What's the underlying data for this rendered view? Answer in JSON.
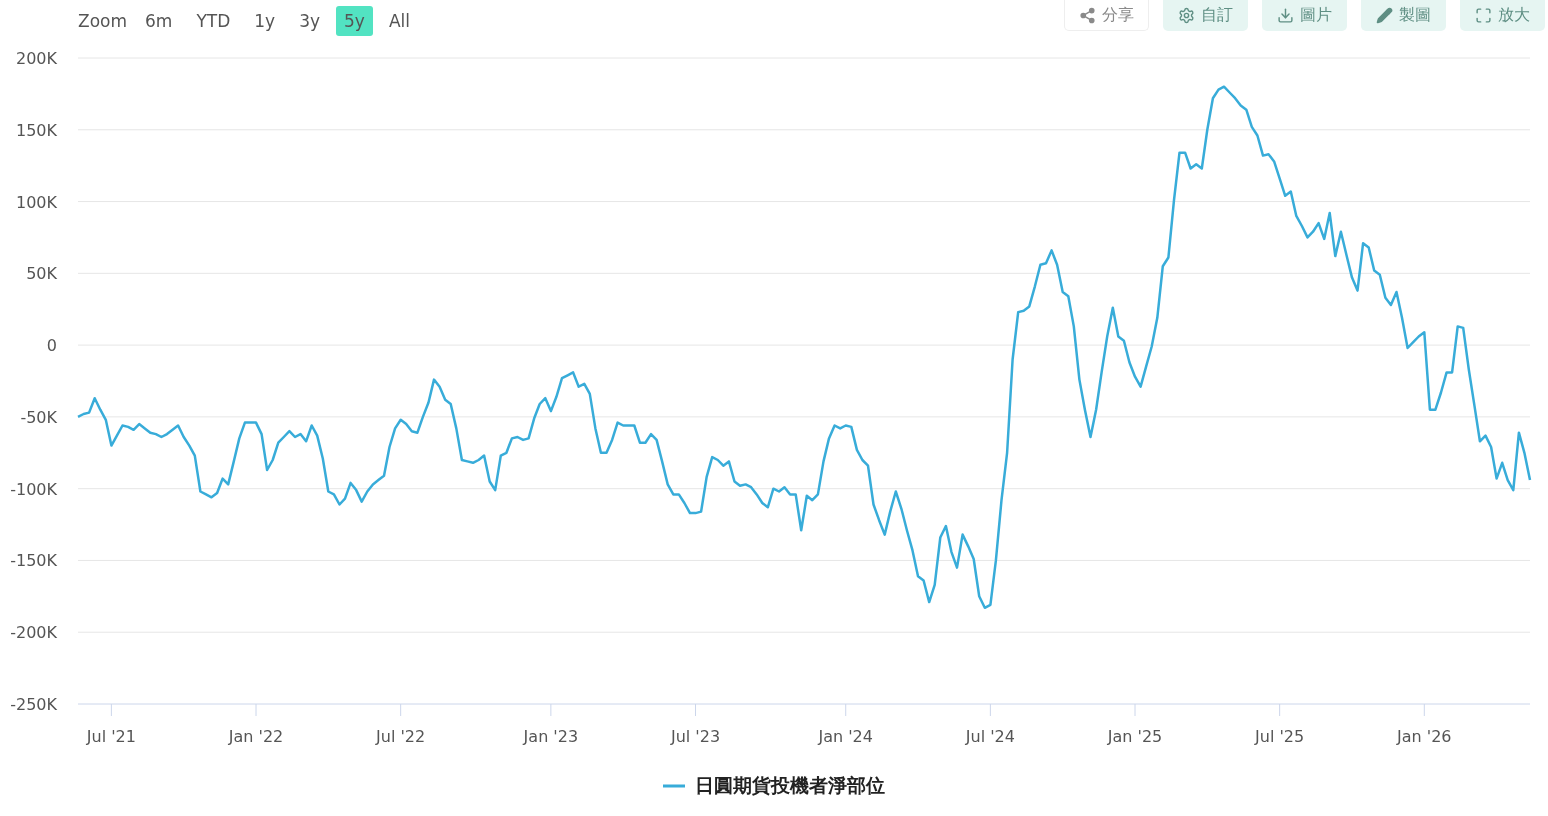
{
  "range_selector": {
    "label": "Zoom",
    "buttons": [
      {
        "label": "6m",
        "selected": false
      },
      {
        "label": "YTD",
        "selected": false
      },
      {
        "label": "1y",
        "selected": false
      },
      {
        "label": "3y",
        "selected": false
      },
      {
        "label": "5y",
        "selected": true
      },
      {
        "label": "All",
        "selected": false
      }
    ]
  },
  "toolbar": [
    {
      "kind": "share",
      "label": "分享"
    },
    {
      "kind": "settings",
      "label": "自訂"
    },
    {
      "kind": "download",
      "label": "圖片"
    },
    {
      "kind": "edit",
      "label": "製圖"
    },
    {
      "kind": "expand",
      "label": "放大"
    }
  ],
  "chart": {
    "chart_data": {
      "type": "line",
      "grid": true,
      "ylim": [
        -250,
        200
      ],
      "yticks": [
        {
          "value": 200,
          "label": "200K"
        },
        {
          "value": 150,
          "label": "150K"
        },
        {
          "value": 100,
          "label": "100K"
        },
        {
          "value": 50,
          "label": "50K"
        },
        {
          "value": 0,
          "label": "0"
        },
        {
          "value": -50,
          "label": "-50K"
        },
        {
          "value": -100,
          "label": "-100K"
        },
        {
          "value": -150,
          "label": "-150K"
        },
        {
          "value": -200,
          "label": "-200K"
        },
        {
          "value": -250,
          "label": "-250K"
        }
      ],
      "categories": [
        null,
        null,
        null,
        null,
        null,
        null,
        "Jul '21",
        null,
        null,
        null,
        null,
        null,
        null,
        null,
        null,
        null,
        null,
        null,
        null,
        null,
        null,
        null,
        null,
        null,
        null,
        null,
        null,
        null,
        null,
        null,
        null,
        null,
        "Jan '22",
        null,
        null,
        null,
        null,
        null,
        null,
        null,
        null,
        null,
        null,
        null,
        null,
        null,
        null,
        null,
        null,
        null,
        null,
        null,
        null,
        null,
        null,
        null,
        null,
        null,
        "Jul '22",
        null,
        null,
        null,
        null,
        null,
        null,
        null,
        null,
        null,
        null,
        null,
        null,
        null,
        null,
        null,
        null,
        null,
        null,
        null,
        null,
        null,
        null,
        null,
        null,
        null,
        null,
        "Jan '23",
        null,
        null,
        null,
        null,
        null,
        null,
        null,
        null,
        null,
        null,
        null,
        null,
        null,
        null,
        null,
        null,
        null,
        null,
        null,
        null,
        null,
        null,
        null,
        null,
        null,
        "Jul '23",
        null,
        null,
        null,
        null,
        null,
        null,
        null,
        null,
        null,
        null,
        null,
        null,
        null,
        null,
        null,
        null,
        null,
        null,
        null,
        null,
        null,
        null,
        null,
        null,
        null,
        null,
        "Jan '24",
        null,
        null,
        null,
        null,
        null,
        null,
        null,
        null,
        null,
        null,
        null,
        null,
        null,
        null,
        null,
        null,
        null,
        null,
        null,
        null,
        null,
        null,
        null,
        null,
        null,
        "Jul '24",
        null,
        null,
        null,
        null,
        null,
        null,
        null,
        null,
        null,
        null,
        null,
        null,
        null,
        null,
        null,
        null,
        null,
        null,
        null,
        null,
        null,
        null,
        null,
        null,
        null,
        "Jan '25",
        null,
        null,
        null,
        null,
        null,
        null,
        null,
        null,
        null,
        null,
        null,
        null,
        null,
        null,
        null,
        null,
        null,
        null,
        null,
        null,
        null,
        null,
        null,
        null,
        null,
        "Jul '25",
        null,
        null,
        null,
        null,
        null,
        null,
        null,
        null,
        null,
        null,
        null,
        null,
        null,
        null,
        null,
        null,
        null,
        null,
        null,
        null,
        null,
        null,
        null,
        null,
        null,
        "Jan '26",
        null,
        null,
        null,
        null,
        null,
        null,
        null,
        null,
        null,
        null,
        null,
        null,
        null,
        null,
        null,
        null,
        null,
        null,
        null
      ],
      "series": [
        {
          "name": "日圓期貨投機者淨部位",
          "color": "#38acd9",
          "values": [
            -50,
            -48,
            -47,
            -37,
            -45,
            -52,
            -70,
            -63,
            -56,
            -57,
            -59,
            -55,
            -58,
            -61,
            -62,
            -64,
            -62,
            -59,
            -56,
            -64,
            -70,
            -77,
            -102,
            -104,
            -106,
            -103,
            -93,
            -97,
            -81,
            -65,
            -54,
            -54,
            -54,
            -62,
            -87,
            -80,
            -68,
            -64,
            -60,
            -64,
            -62,
            -67,
            -56,
            -63,
            -79,
            -102,
            -104,
            -111,
            -107,
            -96,
            -101,
            -109,
            -102,
            -97,
            -94,
            -91,
            -71,
            -58,
            -52,
            -55,
            -60,
            -61,
            -50,
            -40,
            -24,
            -29,
            -38,
            -41,
            -58,
            -80,
            -81,
            -82,
            -80,
            -77,
            -95,
            -101,
            -77,
            -75,
            -65,
            -64,
            -66,
            -65,
            -51,
            -41,
            -37,
            -46,
            -36,
            -23,
            -21,
            -19,
            -29,
            -27,
            -34,
            -58,
            -75,
            -75,
            -66,
            -54,
            -56,
            -56,
            -56,
            -68,
            -68,
            -62,
            -66,
            -81,
            -97,
            -104,
            -104,
            -110,
            -117,
            -117,
            -116,
            -92,
            -78,
            -80,
            -84,
            -81,
            -95,
            -98,
            -97,
            -99,
            -104,
            -110,
            -113,
            -100,
            -102,
            -99,
            -104,
            -104,
            -129,
            -105,
            -108,
            -104,
            -81,
            -65,
            -56,
            -58,
            -56,
            -57,
            -73,
            -80,
            -84,
            -111,
            -122,
            -132,
            -116,
            -102,
            -114,
            -129,
            -143,
            -161,
            -164,
            -179,
            -167,
            -134,
            -126,
            -144,
            -155,
            -132,
            -140,
            -149,
            -175,
            -183,
            -181,
            -150,
            -108,
            -75,
            -10,
            23,
            24,
            27,
            41,
            56,
            57,
            66,
            56,
            37,
            34,
            13,
            -24,
            -45,
            -64,
            -45,
            -19,
            6,
            26,
            6,
            3,
            -12,
            -22,
            -29,
            -15,
            -1,
            19,
            55,
            61,
            101,
            134,
            134,
            123,
            126,
            123,
            150,
            172,
            178,
            180,
            176,
            172,
            167,
            164,
            152,
            146,
            132,
            133,
            128,
            116,
            104,
            107,
            90,
            83,
            75,
            79,
            85,
            74,
            92,
            62,
            79,
            63,
            47,
            38,
            71,
            68,
            52,
            49,
            33,
            28,
            37,
            19,
            -2,
            2,
            6,
            9,
            -45,
            -45,
            -33,
            -19,
            -19,
            13,
            12,
            -17,
            -42,
            -67,
            -63,
            -71,
            -93,
            -82,
            -94,
            -101,
            -61,
            -75,
            -94
          ]
        }
      ]
    }
  }
}
